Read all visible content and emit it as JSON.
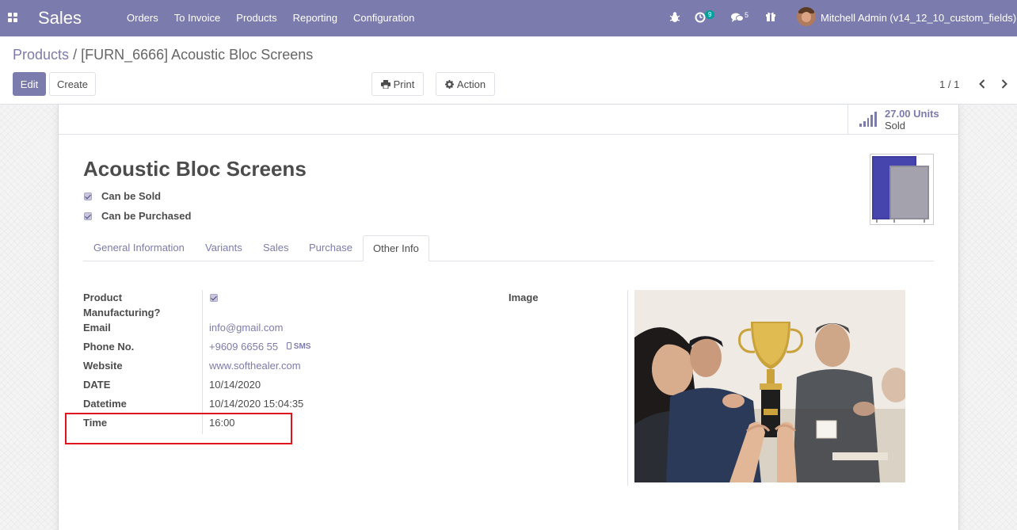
{
  "navbar": {
    "app_name": "Sales",
    "menu": [
      "Orders",
      "To Invoice",
      "Products",
      "Reporting",
      "Configuration"
    ],
    "activity_count": "9",
    "messages_count": "5",
    "user": "Mitchell Admin (v14_12_10_custom_fields)",
    "bg_color": "#7c7bad"
  },
  "breadcrumb": {
    "parent": "Products",
    "separator": "/",
    "current": "[FURN_6666] Acoustic Bloc Screens"
  },
  "buttons": {
    "edit": "Edit",
    "create": "Create",
    "print": "Print",
    "action": "Action"
  },
  "pager": {
    "value": "1 / 1"
  },
  "stat": {
    "value": "27.00 Units",
    "label": "Sold"
  },
  "product": {
    "name": "Acoustic Bloc Screens",
    "can_be_sold": "Can be Sold",
    "can_be_purchased": "Can be Purchased"
  },
  "tabs": [
    "General Information",
    "Variants",
    "Sales",
    "Purchase",
    "Other Info"
  ],
  "fields": {
    "product_manufacturing_label": "Product Manufacturing?",
    "email_label": "Email",
    "email_value": "info@gmail.com",
    "phone_label": "Phone No.",
    "phone_value": "+9609 6656 55",
    "sms_label": "SMS",
    "website_label": "Website",
    "website_value": "www.softhealer.com",
    "date_label": "DATE",
    "date_value": "10/14/2020",
    "datetime_label": "Datetime",
    "datetime_value": "10/14/2020 15:04:35",
    "time_label": "Time",
    "time_value": "16:00",
    "image_label": "Image"
  }
}
